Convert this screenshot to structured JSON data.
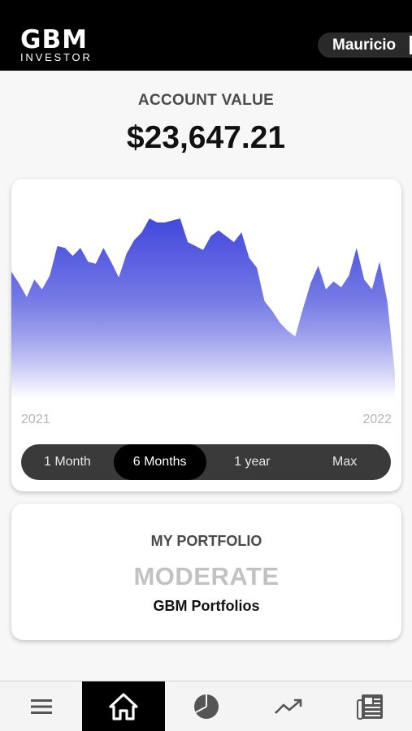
{
  "header": {
    "logo_main": "GBM",
    "logo_sub": "INVESTOR",
    "user_name": "Mauricio"
  },
  "account": {
    "label": "ACCOUNT VALUE",
    "value": "$23,647.21"
  },
  "chart_data": {
    "type": "area",
    "x_start_label": "2021",
    "x_end_label": "2022",
    "values": [
      61,
      55,
      48,
      57,
      52,
      59,
      74,
      73,
      69,
      73,
      66,
      65,
      73,
      66,
      58,
      70,
      77,
      81,
      88,
      86,
      86,
      87,
      88,
      76,
      74,
      72,
      79,
      82,
      79,
      76,
      81,
      68,
      63,
      46,
      41,
      35,
      31,
      28,
      42,
      55,
      64,
      52,
      56,
      53,
      59,
      73,
      57,
      52,
      66,
      46,
      9
    ],
    "ylim": [
      0,
      100
    ],
    "grid": false,
    "colors": {
      "fill_top": "#4148dc",
      "fill_bottom": "#ffffff"
    }
  },
  "range_selector": {
    "options": [
      "1 Month",
      "6 Months",
      "1 year",
      "Max"
    ],
    "selected": "6 Months"
  },
  "portfolio": {
    "label": "MY PORTFOLIO",
    "level": "MODERATE",
    "name": "GBM Portfolios"
  },
  "tabbar": {
    "tabs": [
      "menu-icon",
      "home-icon",
      "pie-chart-icon",
      "trending-icon",
      "news-icon"
    ],
    "active": "home-icon"
  }
}
